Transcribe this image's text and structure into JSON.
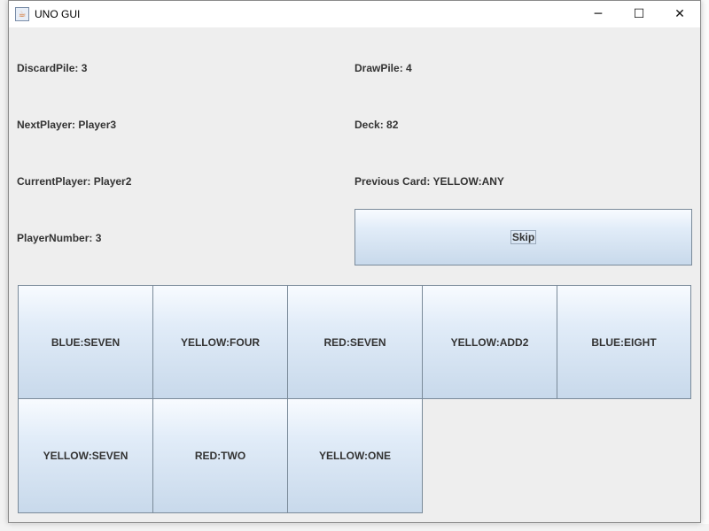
{
  "window": {
    "title": "UNO GUI",
    "controls": {
      "minimize": "─",
      "maximize": "☐",
      "close": "✕"
    }
  },
  "info": {
    "discard_pile": "DiscardPile: 3",
    "draw_pile": "DrawPile: 4",
    "next_player": "NextPlayer: Player3",
    "deck": "Deck: 82",
    "current_player": "CurrentPlayer: Player2",
    "previous_card": "Previous Card: YELLOW:ANY",
    "player_number": "PlayerNumber: 3"
  },
  "actions": {
    "skip_label": "Skip"
  },
  "hand": [
    {
      "label": "BLUE:SEVEN"
    },
    {
      "label": "YELLOW:FOUR"
    },
    {
      "label": "RED:SEVEN"
    },
    {
      "label": "YELLOW:ADD2"
    },
    {
      "label": "BLUE:EIGHT"
    },
    {
      "label": "YELLOW:SEVEN"
    },
    {
      "label": "RED:TWO"
    },
    {
      "label": "YELLOW:ONE"
    }
  ]
}
